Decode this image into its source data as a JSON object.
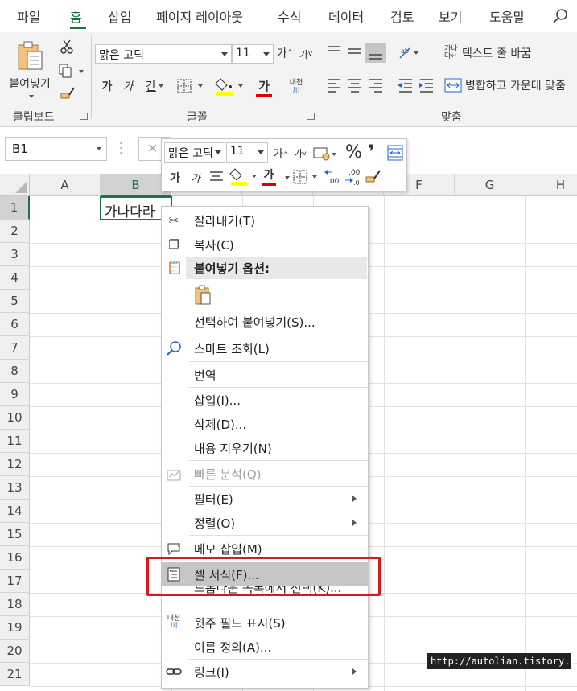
{
  "ribbon_tabs": [
    "파일",
    "홈",
    "삽입",
    "페이지 레이아웃",
    "수식",
    "데이터",
    "검토",
    "보기",
    "도움말"
  ],
  "active_tab": "홈",
  "ribbon": {
    "paste_label": "붙여넣기",
    "clipboard_label": "클립보드",
    "font_label": "글꼴",
    "align_label": "맞춤",
    "font_name": "맑은 고딕",
    "font_size": "11",
    "grow_font": "가",
    "shrink_font": "가",
    "bold": "가",
    "italic": "가",
    "underline": "간",
    "font_color_letter": "가",
    "wrap_text": "텍스트 줄 바꿈",
    "merge_center": "병합하고 가운데 맞춤",
    "phonetic": "내천",
    "phonetic_small": "가나",
    "wrap_small": "다"
  },
  "formula_bar": {
    "name_box": "B1"
  },
  "columns": [
    "A",
    "B",
    "C",
    "D",
    "E",
    "F",
    "G",
    "H"
  ],
  "rows": [
    "1",
    "2",
    "3",
    "4",
    "5",
    "6",
    "7",
    "8",
    "9",
    "10",
    "11",
    "12",
    "13",
    "14",
    "15",
    "16",
    "17",
    "18",
    "19",
    "20",
    "21"
  ],
  "active_cell": {
    "ref": "B1",
    "value": "가나다라"
  },
  "mini_toolbar": {
    "font_name": "맑은 고딕",
    "font_size": "11",
    "percent": "%",
    "comma": "❜",
    "bold": "가",
    "italic": "가",
    "font_color_letter": "가",
    "grow_font": "가",
    "shrink_font": "가",
    "dec_inc": "←.0\n.00",
    "dec_dec": ".00\n→.0"
  },
  "context_menu": [
    {
      "label": "잘라내기(T)",
      "icon": "scissors-icon"
    },
    {
      "label": "복사(C)",
      "icon": "copy-icon"
    },
    {
      "label": "붙여넣기 옵션:",
      "icon": "paste-icon",
      "header": true
    },
    {
      "label": "",
      "icon": "paste-option-icon"
    },
    {
      "label": "선택하여 붙여넣기(S)...",
      "icon": ""
    },
    {
      "label": "스마트 조회(L)",
      "icon": "smart-lookup-icon"
    },
    {
      "label": "번역",
      "icon": ""
    },
    {
      "label": "삽입(I)...",
      "icon": ""
    },
    {
      "label": "삭제(D)...",
      "icon": ""
    },
    {
      "label": "내용 지우기(N)",
      "icon": ""
    },
    {
      "label": "빠른 분석(Q)",
      "icon": "quick-analysis-icon",
      "disabled": true
    },
    {
      "label": "필터(E)",
      "icon": "",
      "submenu": true
    },
    {
      "label": "정렬(O)",
      "icon": "",
      "submenu": true
    },
    {
      "label": "메모 삽입(M)",
      "icon": "comment-icon"
    },
    {
      "label": "셀 서식(F)...",
      "icon": "format-cells-icon",
      "highlighted": true
    },
    {
      "label": "드롭다운 목록에서 선택(K)...",
      "icon": ""
    },
    {
      "label": "윗주 필드 표시(S)",
      "icon": "phonetic-icon"
    },
    {
      "label": "이름 정의(A)...",
      "icon": ""
    },
    {
      "label": "링크(I)",
      "icon": "link-icon",
      "submenu": true
    }
  ],
  "watermark": "http://autolian.tistory.com",
  "colors": {
    "excel_green": "#217346",
    "highlight_red": "#d41c1c",
    "font_color_bar": "#e00000",
    "fill_color_bar": "#ffff00"
  }
}
